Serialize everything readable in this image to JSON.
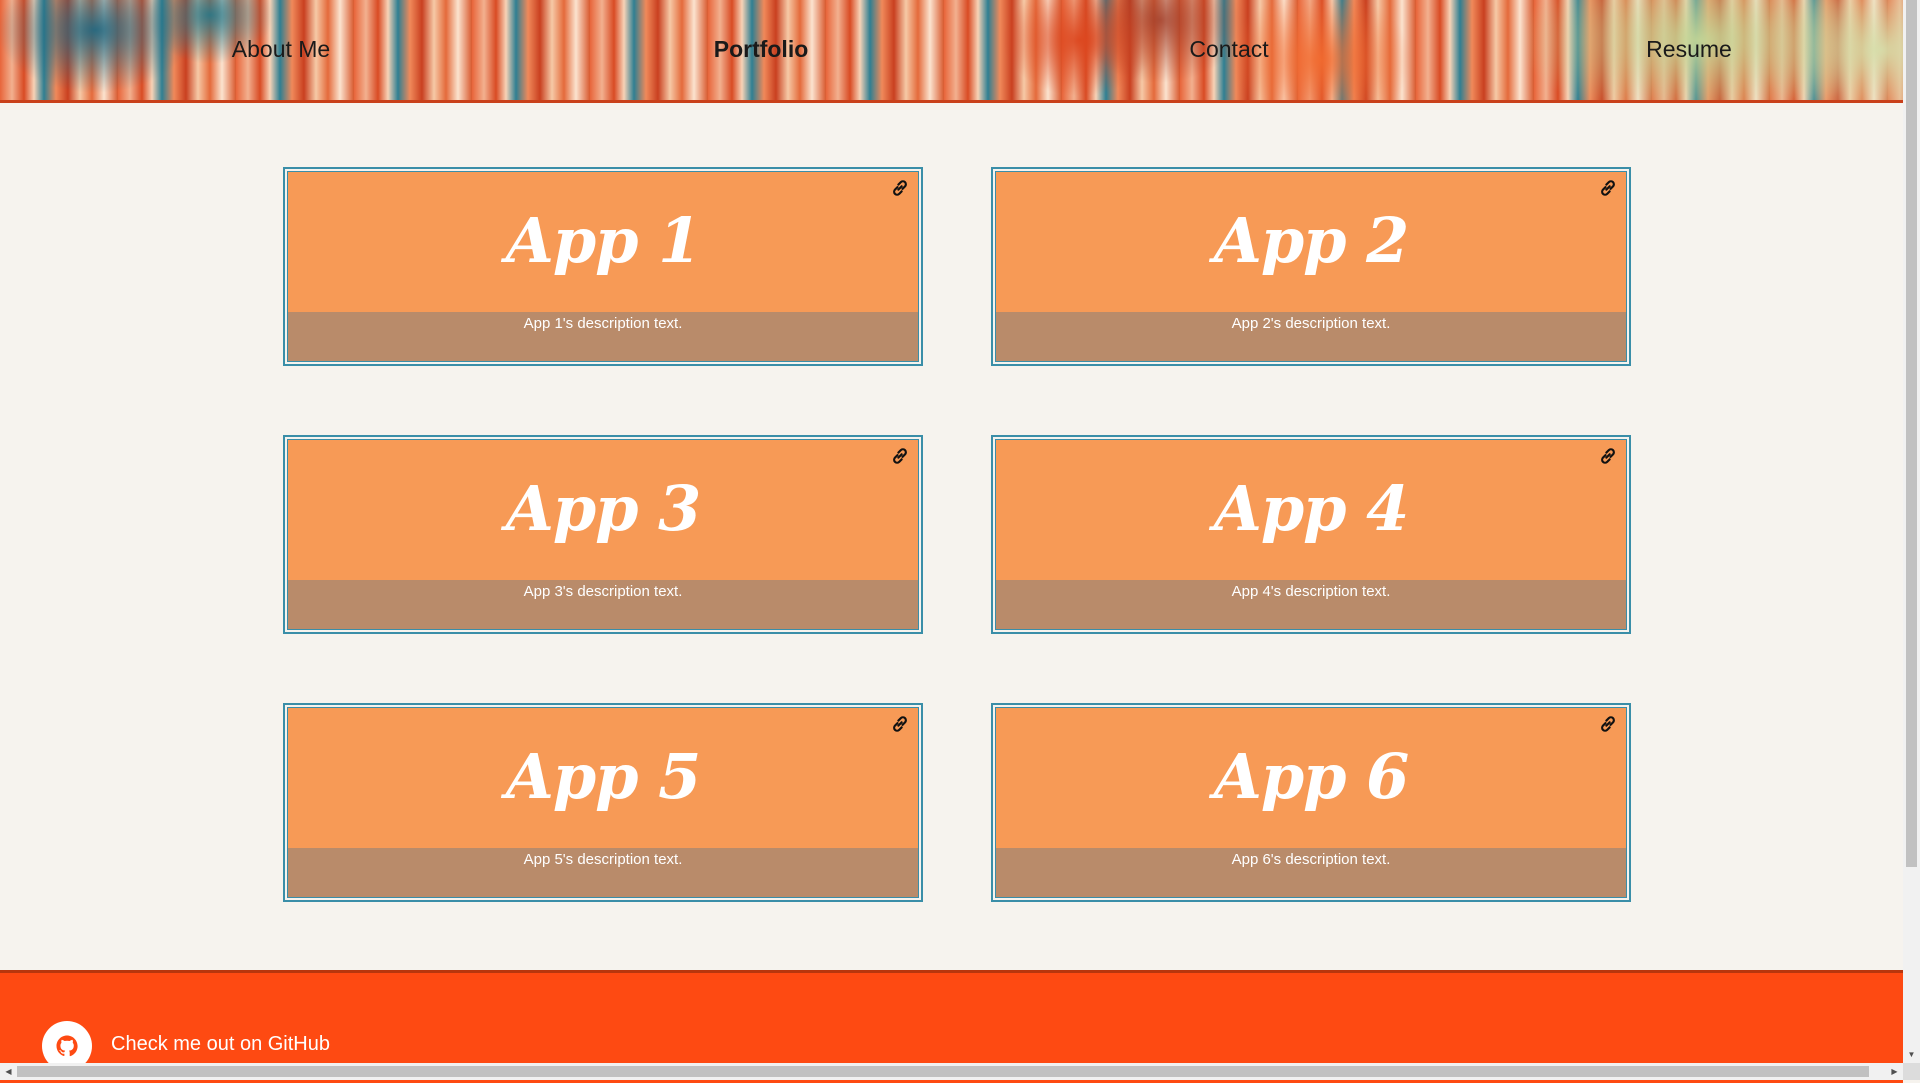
{
  "nav": {
    "items": [
      {
        "label": "About Me",
        "active": false
      },
      {
        "label": "Portfolio",
        "active": true
      },
      {
        "label": "Contact",
        "active": false
      },
      {
        "label": "Resume",
        "active": false
      }
    ]
  },
  "portfolio": {
    "cards": [
      {
        "title": "App 1",
        "description": "App 1's description text.",
        "icon": "link-icon"
      },
      {
        "title": "App 2",
        "description": "App 2's description text.",
        "icon": "link-icon"
      },
      {
        "title": "App 3",
        "description": "App 3's description text.",
        "icon": "link-icon"
      },
      {
        "title": "App 4",
        "description": "App 4's description text.",
        "icon": "link-icon"
      },
      {
        "title": "App 5",
        "description": "App 5's description text.",
        "icon": "link-icon"
      },
      {
        "title": "App 6",
        "description": "App 6's description text.",
        "icon": "link-icon"
      }
    ]
  },
  "footer": {
    "github_label": "Check me out on GitHub",
    "icon": "github-icon"
  },
  "scrollbars": {
    "up_arrow": "▲",
    "down_arrow": "▼",
    "left_arrow": "◀",
    "right_arrow": "▶"
  },
  "colors": {
    "card_fill": "#f79a56",
    "card_desc_band": "#b98b6a",
    "card_border": "#3a8ea8",
    "footer": "#fe4a12",
    "page_background": "#f6f3ee"
  }
}
